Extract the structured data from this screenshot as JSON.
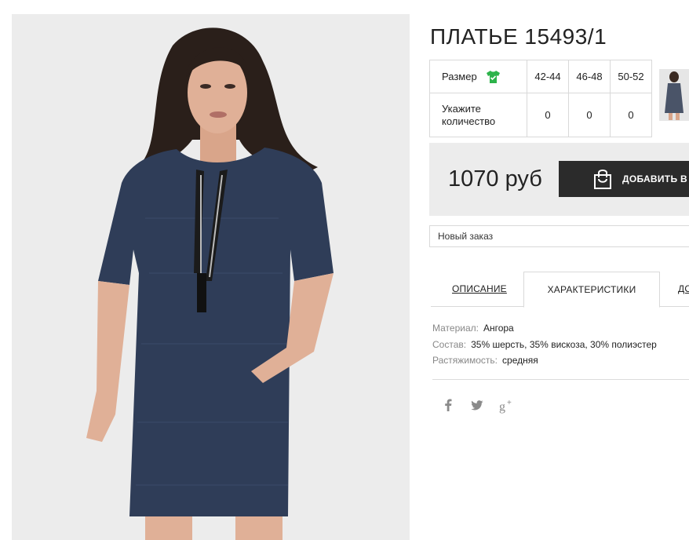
{
  "product": {
    "title": "ПЛАТЬЕ 15493/1",
    "image_alt": "Woman in dark blue melange dress with zipper"
  },
  "sizes": {
    "header_label": "Размер",
    "qty_label": "Укажите количество",
    "icon": "tshirt-icon",
    "icon_color": "#2db34a",
    "columns": [
      "42-44",
      "46-48",
      "50-52"
    ],
    "quantities": [
      "0",
      "0",
      "0"
    ]
  },
  "price": {
    "amount": "1070 руб",
    "add_to_cart_label": "ДОБАВИТЬ В З",
    "cart_icon": "shopping-bag-icon"
  },
  "order_select": {
    "value": "Новый заказ"
  },
  "tabs": [
    {
      "label": "ОПИСАНИЕ",
      "active": false
    },
    {
      "label": "ХАРАКТЕРИСТИКИ",
      "active": true
    },
    {
      "label": "ДО",
      "active": false
    }
  ],
  "specs": [
    {
      "key": "Материал:",
      "value": "Ангора"
    },
    {
      "key": "Состав:",
      "value": "35% шерсть, 35% вискоза, 30% полиэстер"
    },
    {
      "key": "Растяжимость:",
      "value": "средняя"
    }
  ],
  "social": [
    "facebook-icon",
    "twitter-icon",
    "google-plus-icon"
  ],
  "colors": {
    "dress": "#2f3d58",
    "button_bg": "#2b2b2b",
    "panel_bg": "#ececec",
    "border": "#d9d9d9"
  }
}
